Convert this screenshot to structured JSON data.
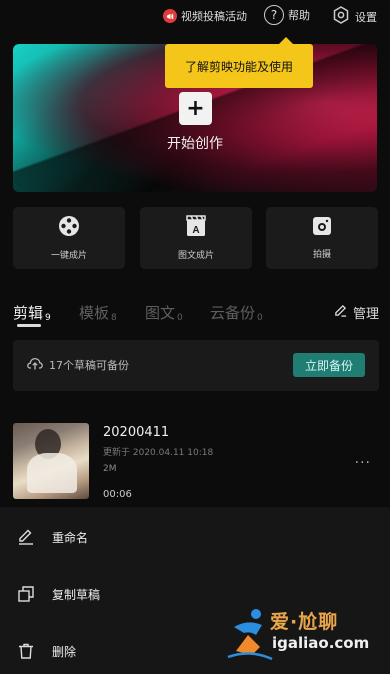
{
  "topbar": {
    "promo_label": "视频投稿活动",
    "help_label": "帮助",
    "settings_label": "设置"
  },
  "tooltip": {
    "text": "了解剪映功能及使用"
  },
  "hero": {
    "create_label": "开始创作"
  },
  "quick_actions": [
    {
      "label": "一键成片",
      "icon": "film-reel-icon"
    },
    {
      "label": "图文成片",
      "icon": "clapper-text-icon"
    },
    {
      "label": "拍摄",
      "icon": "camera-icon"
    }
  ],
  "tabs": [
    {
      "label": "剪辑",
      "count": "9",
      "active": true
    },
    {
      "label": "模板",
      "count": "8",
      "active": false
    },
    {
      "label": "图文",
      "count": "0",
      "active": false
    },
    {
      "label": "云备份",
      "count": "0",
      "active": false
    }
  ],
  "manage_label": "管理",
  "backup": {
    "info": "17个草稿可备份",
    "button": "立即备份"
  },
  "draft": {
    "title": "20200411",
    "updated": "更新于 2020.04.11 10:18",
    "size": "2M",
    "duration": "00:06"
  },
  "sheet": {
    "rename": "重命名",
    "duplicate": "复制草稿",
    "delete": "删除"
  },
  "watermark": {
    "brand": "爱·尬聊",
    "url": "igaliao.com"
  },
  "colors": {
    "tooltip_bg": "#f4c61a",
    "backup_button": "#1f7d73",
    "hero_teal": "#19d0c4",
    "hero_pink": "#e6285a"
  }
}
